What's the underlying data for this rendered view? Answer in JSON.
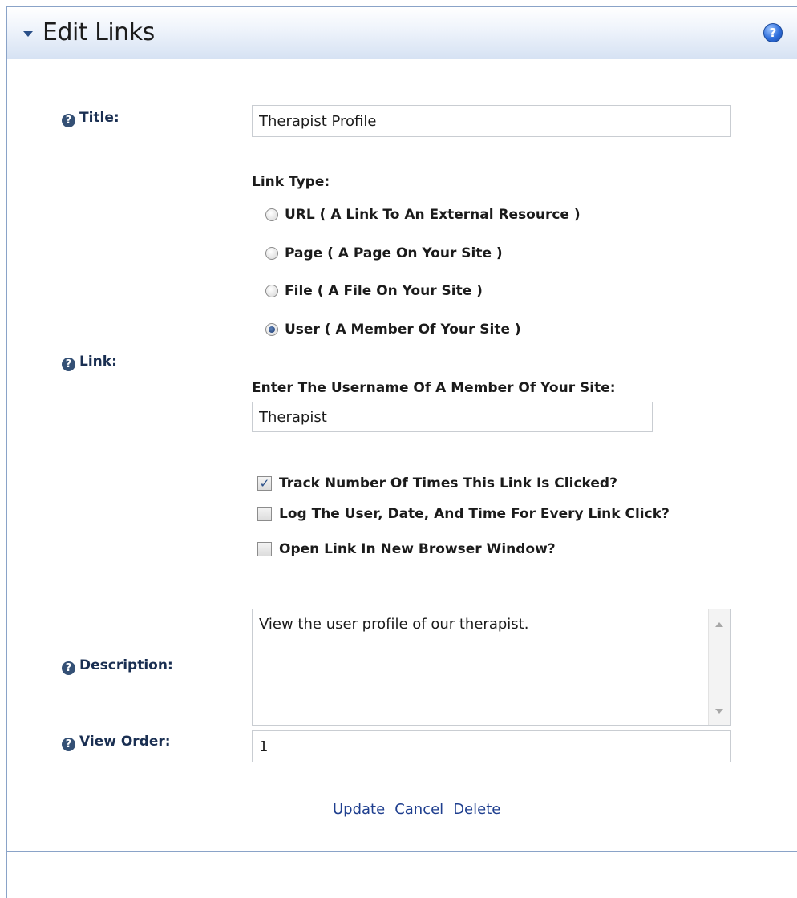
{
  "header": {
    "title": "Edit Links",
    "help_icon": "help-circle-icon"
  },
  "fields": {
    "title": {
      "label": "Title:",
      "value": "Therapist Profile"
    },
    "link": {
      "label": "Link:",
      "link_type_label": "Link Type:",
      "options": [
        {
          "label": "URL ( A Link To An External Resource )",
          "checked": false
        },
        {
          "label": "Page ( A Page On Your Site )",
          "checked": false
        },
        {
          "label": "File ( A File On Your Site )",
          "checked": false
        },
        {
          "label": "User ( A Member Of Your Site )",
          "checked": true
        }
      ],
      "username_label": "Enter The Username Of A Member Of Your Site:",
      "username_value": "Therapist"
    },
    "checkboxes": [
      {
        "label": "Track Number Of Times This Link Is Clicked?",
        "checked": true
      },
      {
        "label": "Log The User, Date, And Time For Every Link Click?",
        "checked": false
      },
      {
        "label": "Open Link In New Browser Window?",
        "checked": false
      }
    ],
    "description": {
      "label": "Description:",
      "value": "View the user profile of our therapist."
    },
    "view_order": {
      "label": "View Order:",
      "value": "1"
    }
  },
  "actions": {
    "update": "Update",
    "cancel": "Cancel",
    "delete": "Delete"
  },
  "colors": {
    "header_gradient_end": "#d6e2f3",
    "label_text": "#1a2f52",
    "link": "#1f3f8f",
    "border": "#8aa3c8"
  }
}
